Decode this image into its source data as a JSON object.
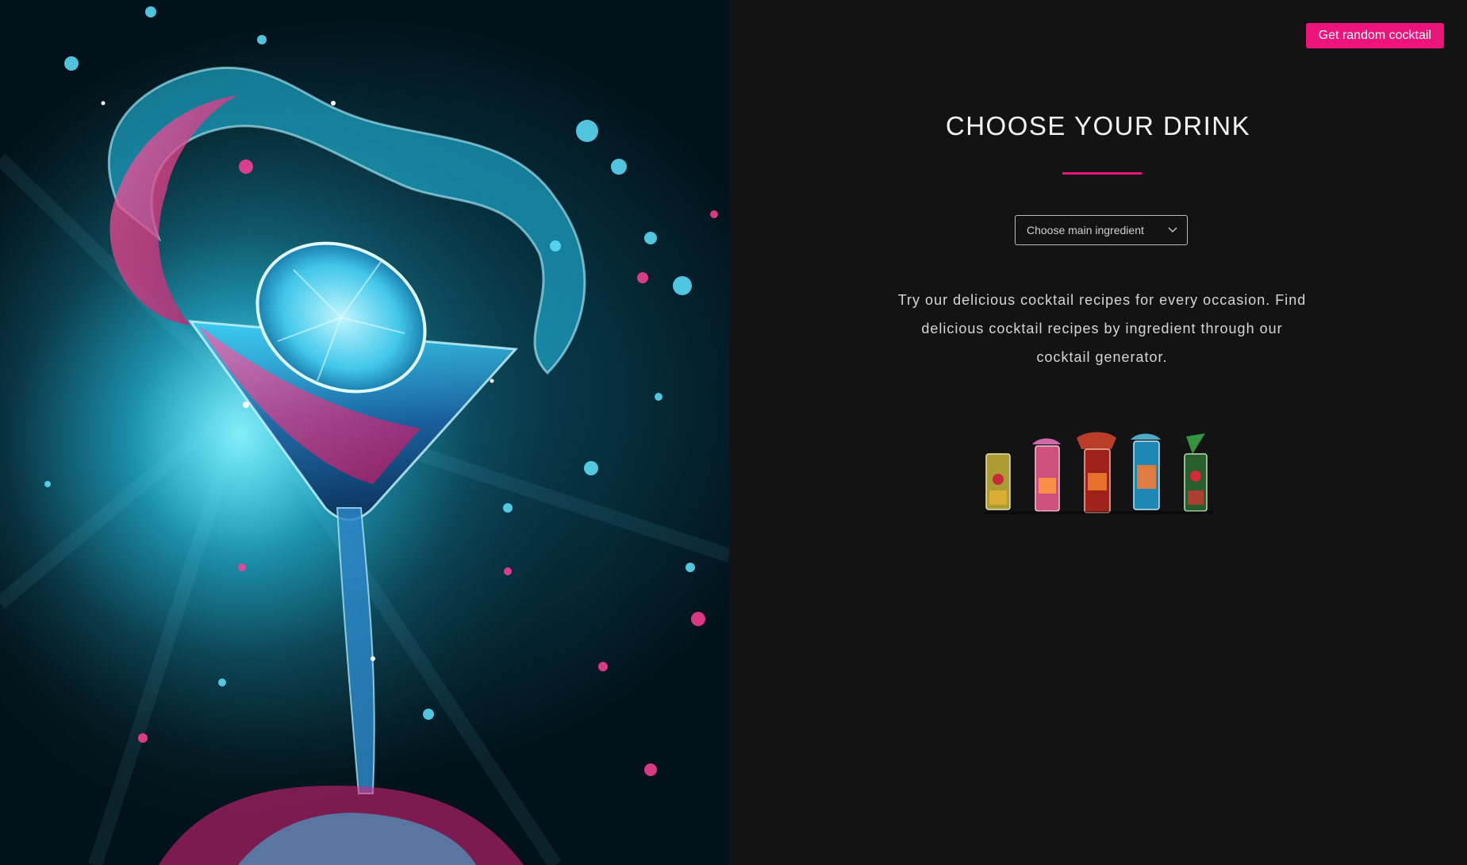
{
  "hero": {
    "image": "cocktail-splash-image"
  },
  "header": {
    "random_button_label": "Get random cocktail"
  },
  "main": {
    "title": "CHOOSE YOUR DRINK",
    "select": {
      "selected_label": "Choose main ingredient",
      "icon": "chevron-down-icon"
    },
    "description": "Try our delicious cocktail recipes for every occasion. Find delicious cocktail recipes by ingredient through our cocktail generator.",
    "glasses_image": "cocktail-glasses-image"
  },
  "colors": {
    "accent": "#ec137b",
    "panel_background": "#131313",
    "title_text": "#f4f4f4",
    "body_text": "#d6d6d6"
  }
}
